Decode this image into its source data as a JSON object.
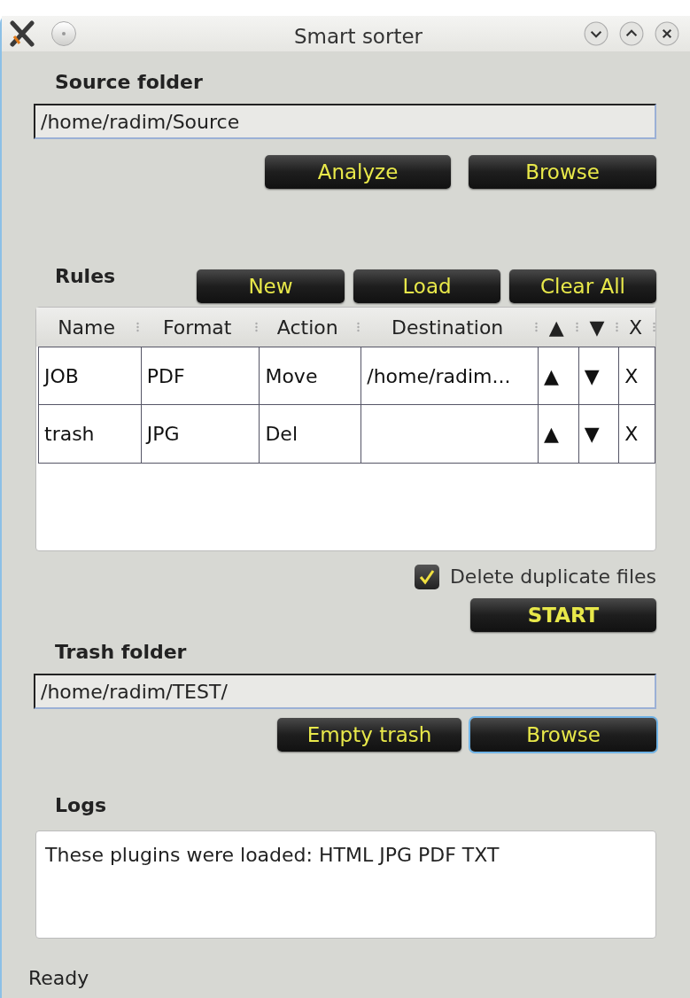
{
  "window": {
    "title": "Smart sorter"
  },
  "source": {
    "label": "Source folder",
    "value": "/home/radim/Source",
    "buttons": [
      {
        "label": "Analyze",
        "focused": false
      },
      {
        "label": "Browse",
        "focused": false
      }
    ]
  },
  "rules": {
    "label": "Rules",
    "buttons": [
      {
        "label": "New",
        "focused": false
      },
      {
        "label": "Load",
        "focused": false
      },
      {
        "label": "Clear All",
        "focused": false
      }
    ],
    "columns": [
      "Name",
      "Format",
      "Action",
      "Destination",
      "▲",
      "▼",
      "X"
    ],
    "rows": [
      {
        "cells": [
          "JOB",
          "PDF",
          "Move",
          "/home/radim...",
          "▲",
          "▼",
          "X"
        ]
      },
      {
        "cells": [
          "trash",
          "JPG",
          "Del",
          null,
          "▲",
          "▼",
          "X"
        ]
      }
    ]
  },
  "delete_duplicates": {
    "label": "Delete duplicate files",
    "checked": true
  },
  "start_button": {
    "label": "START",
    "focused": false
  },
  "trash": {
    "label": "Trash folder",
    "value": "/home/radim/TEST/",
    "buttons": [
      {
        "label": "Empty trash",
        "focused": false
      },
      {
        "label": "Browse",
        "focused": true
      }
    ]
  },
  "logs": {
    "label": "Logs",
    "text": "These plugins were loaded: HTML JPG PDF TXT"
  },
  "status_bar": {
    "text": "Ready"
  }
}
